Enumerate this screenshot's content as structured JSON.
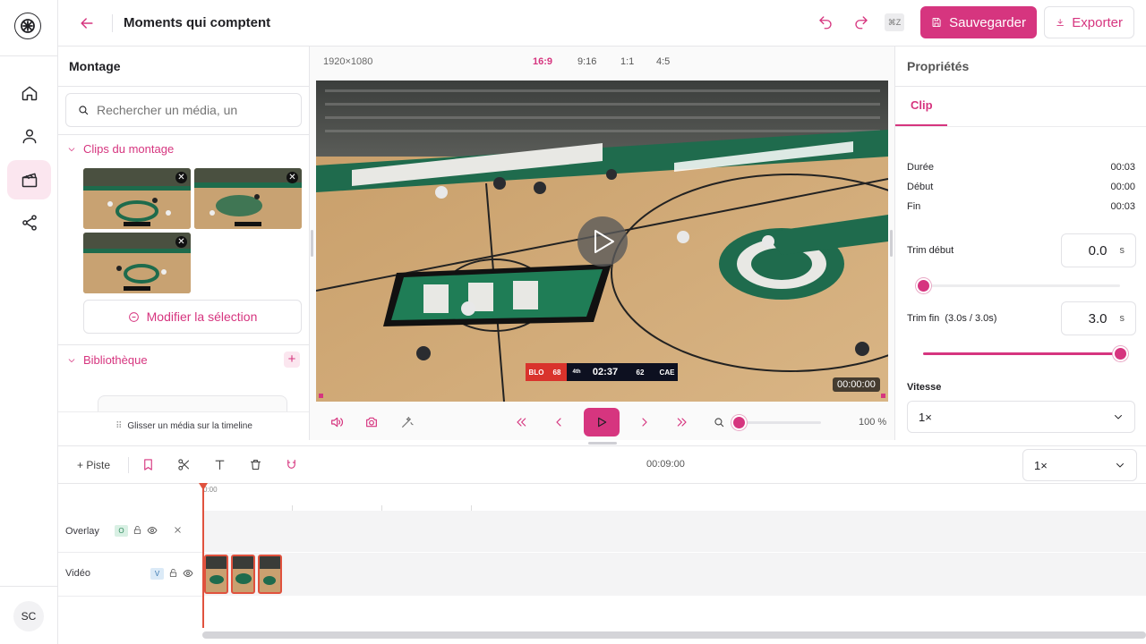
{
  "header": {
    "title": "Moments qui comptent",
    "shortcut_badge": "⌘Z",
    "save_label": "Sauvegarder",
    "export_label": "Exporter"
  },
  "rail": {
    "items": [
      "home-icon",
      "user-icon",
      "clapperboard-icon",
      "share-icon"
    ],
    "active": "clapperboard-icon",
    "avatar_initials": "SC"
  },
  "left_panel": {
    "title": "Montage",
    "search_placeholder": "Rechercher un média, un",
    "clips_section": "Clips du montage",
    "edit_selection": "Modifier la sélection",
    "library_section": "Bibliothèque",
    "drag_hint": "Glisser un média sur la timeline"
  },
  "preview": {
    "resolution": "1920×1080",
    "ratios": [
      "16:9",
      "9:16",
      "1:1",
      "4:5"
    ],
    "active_ratio": "16:9",
    "timecode": "00:00:00",
    "zoom_percent": "100 %",
    "zoom_level": 0
  },
  "scoreboard": {
    "home": "BLO",
    "home_score": "68",
    "period": "4th",
    "clock": "02:37",
    "away_score": "62",
    "away": "CAE"
  },
  "right_panel": {
    "title": "Propriétés",
    "tab": "Clip",
    "rows": [
      {
        "label": "Durée",
        "value": "00:03"
      },
      {
        "label": "Début",
        "value": "00:00"
      },
      {
        "label": "Fin",
        "value": "00:03"
      }
    ],
    "trim_start_label": "Trim début",
    "trim_start_value": "0.0",
    "trim_end_label": "Trim fin  (3.0s / 3.0s)",
    "trim_end_value": "3.0",
    "unit": "s",
    "trim_start_fraction": 0,
    "trim_end_fraction": 1,
    "speed_label": "Vitesse",
    "speed_value": "1×"
  },
  "timeline": {
    "add_track": "+ Piste",
    "duration": "00:09:00",
    "speed_value": "1×",
    "ruler_start": "0:00",
    "tracks": [
      {
        "name": "Overlay",
        "badge": "O"
      },
      {
        "name": "Vidéo",
        "badge": "V"
      }
    ],
    "clip_count": 3
  },
  "colors": {
    "accent": "#d6357f",
    "accent_soft": "#fbe6ef",
    "playhead": "#e0523e"
  }
}
